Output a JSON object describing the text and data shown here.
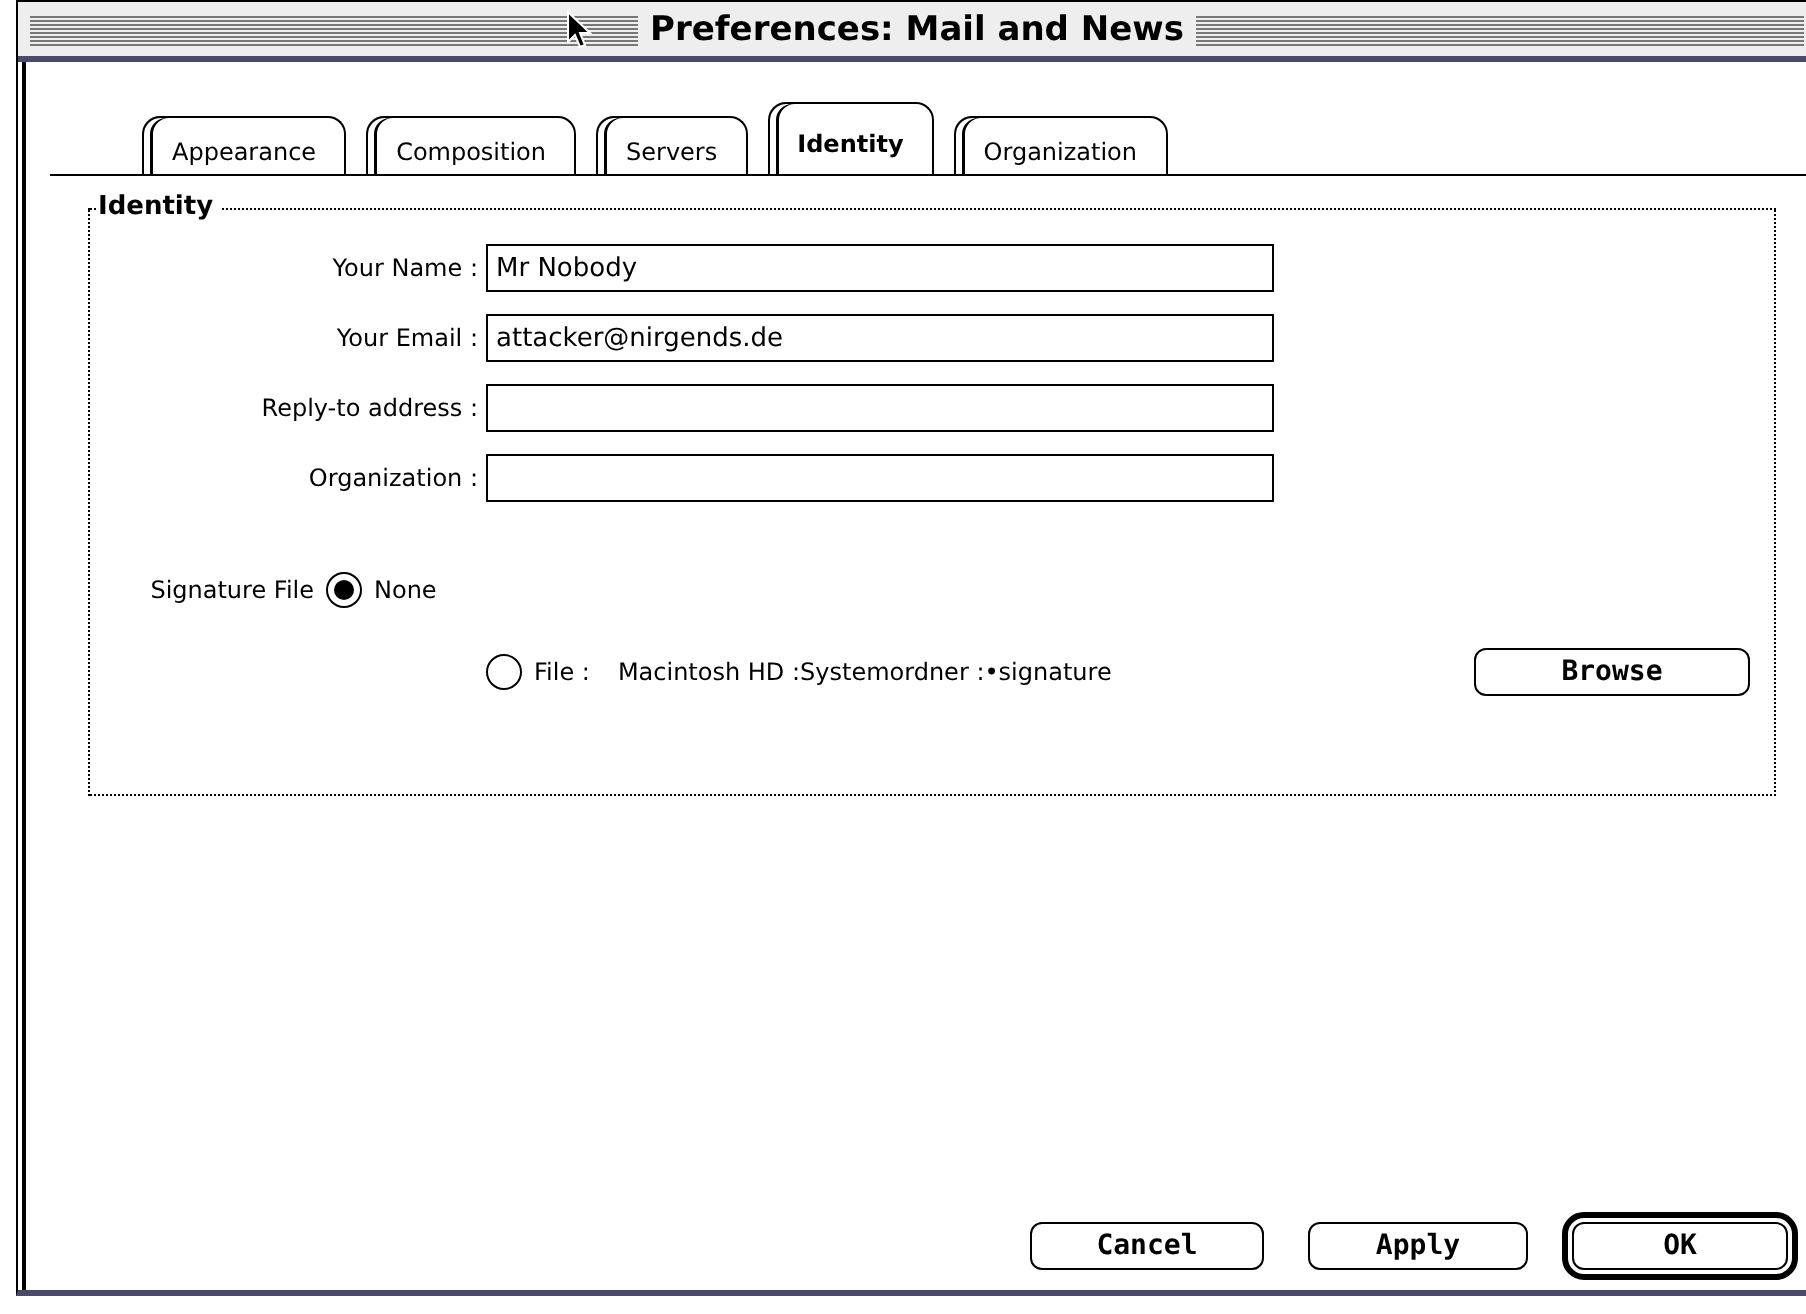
{
  "window": {
    "title": "Preferences: Mail and News"
  },
  "tabs": [
    {
      "label": "Appearance",
      "selected": false
    },
    {
      "label": "Composition",
      "selected": false
    },
    {
      "label": "Servers",
      "selected": false
    },
    {
      "label": "Identity",
      "selected": true
    },
    {
      "label": "Organization",
      "selected": false
    }
  ],
  "group": {
    "title": "Identity"
  },
  "fields": [
    {
      "label": "Your Name :",
      "value": "Mr Nobody"
    },
    {
      "label": "Your Email :",
      "value": "attacker@nirgends.de"
    },
    {
      "label": "Reply-to address :"
    },
    {
      "label": "Organization :"
    }
  ],
  "signature": {
    "label": "Signature File",
    "options": [
      {
        "label": "None",
        "selected": true
      },
      {
        "label": "File :",
        "path": "Macintosh HD :Systemordner :•signature",
        "selected": false
      }
    ],
    "browse": "Browse"
  },
  "buttons": [
    {
      "label": "Cancel",
      "default": false
    },
    {
      "label": "Apply",
      "default": false
    },
    {
      "label": "OK",
      "default": true
    }
  ]
}
